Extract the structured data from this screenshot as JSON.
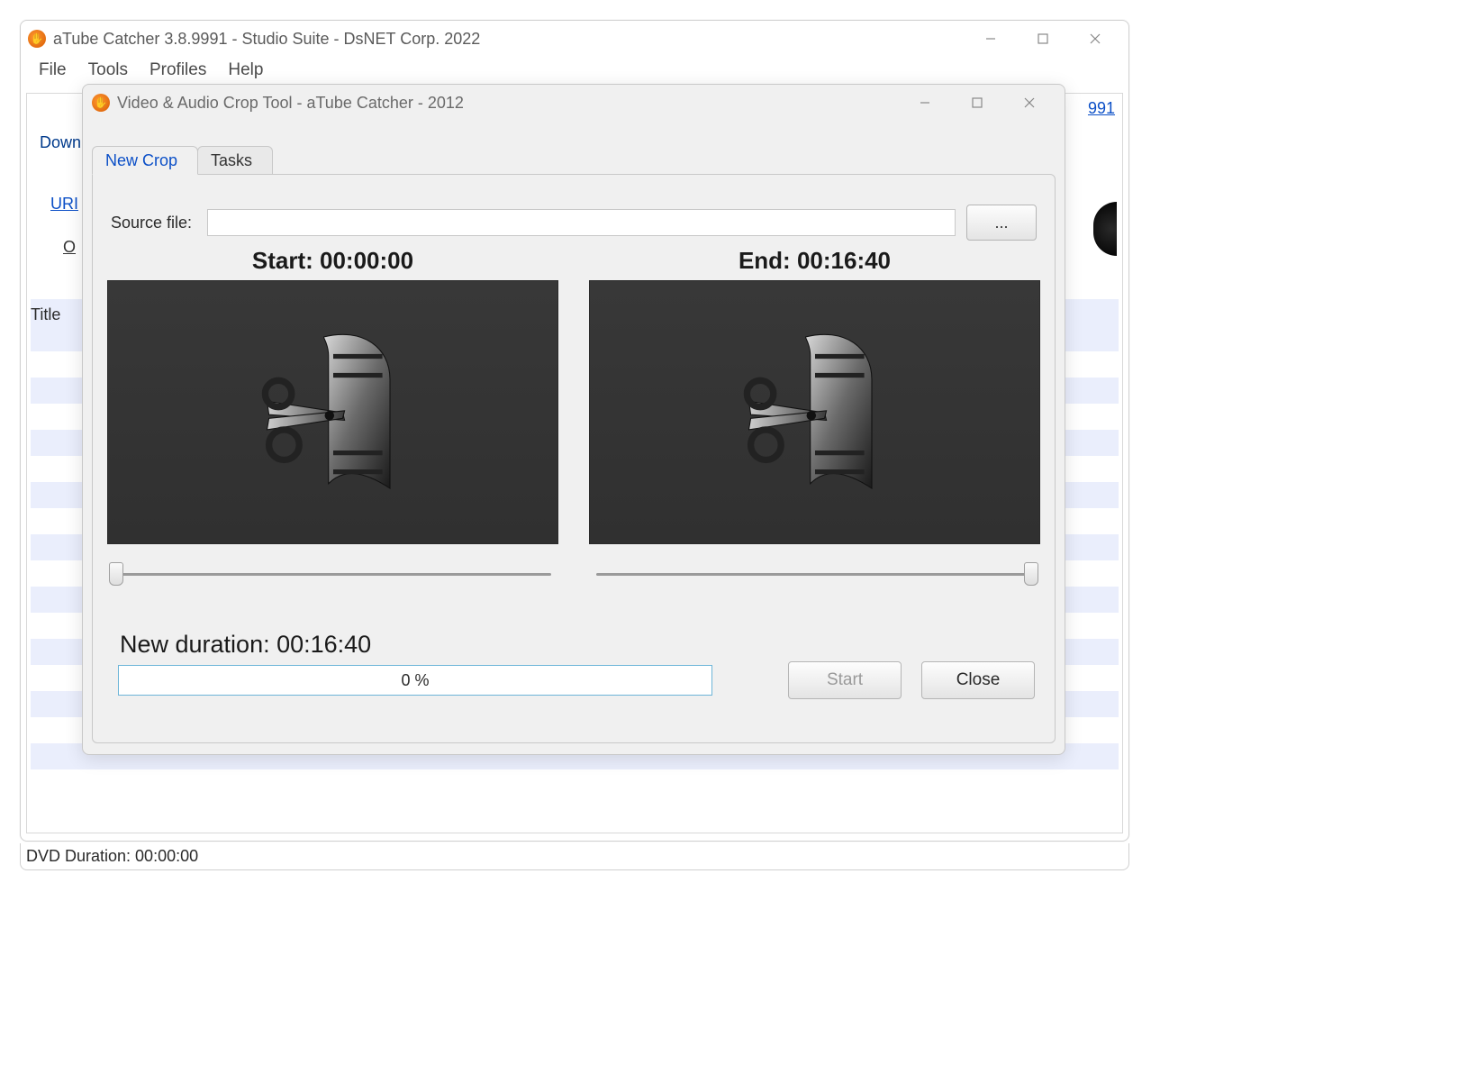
{
  "main": {
    "title": "aTube Catcher 3.8.9991 - Studio Suite - DsNET Corp. 2022",
    "menus": [
      "File",
      "Tools",
      "Profiles",
      "Help"
    ],
    "partial_tab": "Down",
    "partial_link": "URI",
    "partial_o": "O",
    "title_column": "Title",
    "top_right_link_fragment": "991",
    "statusbar": "DVD Duration: 00:00:00"
  },
  "modal": {
    "title": "Video & Audio Crop Tool - aTube Catcher - 2012",
    "tabs": {
      "new_crop": "New Crop",
      "tasks": "Tasks"
    },
    "source_label": "Source file:",
    "source_value": "",
    "browse_label": "...",
    "start_label": "Start: 00:00:00",
    "end_label": "End: 00:16:40",
    "new_duration": "New duration: 00:16:40",
    "progress_text": "0 %",
    "start_button": "Start",
    "close_button": "Close"
  }
}
